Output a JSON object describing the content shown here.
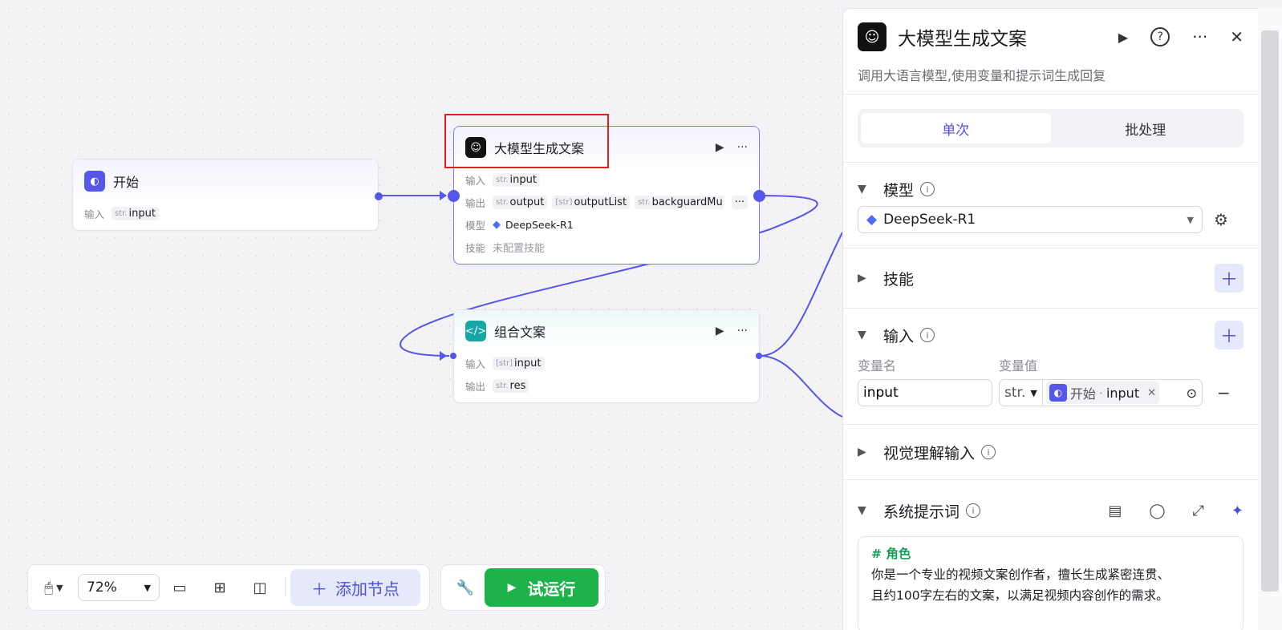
{
  "canvas": {
    "start_node": {
      "title": "开始",
      "input_label": "输入",
      "input_type": "str.",
      "input_name": "input"
    },
    "llm_node": {
      "title": "大模型生成文案",
      "input_label": "输入",
      "input_type": "str.",
      "input_name": "input",
      "output_label": "输出",
      "outputs": [
        {
          "type": "str.",
          "name": "output"
        },
        {
          "type": "[str]",
          "name": "outputList"
        },
        {
          "type": "str.",
          "name": "backguardMu"
        }
      ],
      "model_label": "模型",
      "model_name": "DeepSeek-R1",
      "skill_label": "技能",
      "skill_value": "未配置技能"
    },
    "code_node": {
      "title": "组合文案",
      "input_label": "输入",
      "input_type": "[str]",
      "input_name": "input",
      "output_label": "输出",
      "output_type": "str.",
      "output_name": "res"
    }
  },
  "toolbar": {
    "zoom": "72%",
    "add_node_label": "添加节点",
    "run_label": "试运行"
  },
  "panel": {
    "title": "大模型生成文案",
    "description": "调用大语言模型,使用变量和提示词生成回复",
    "tabs": [
      "单次",
      "批处理"
    ],
    "model_section": "模型",
    "model_value": "DeepSeek-R1",
    "skill_section": "技能",
    "input_section": "输入",
    "var_name_header": "变量名",
    "var_value_header": "变量值",
    "var_name": "input",
    "var_type": "str.",
    "var_ref_node": "开始",
    "var_ref_sep": "·",
    "var_ref_name": "input",
    "vision_section": "视觉理解输入",
    "system_prompt_section": "系统提示词",
    "prompt_heading": "# 角色",
    "prompt_line1": "你是一个专业的视频文案创作者，擅长生成紧密连贯、",
    "prompt_line2": "且约100字左右的文案，以满足视频内容创作的需求。"
  },
  "colors": {
    "accent": "#5457e8",
    "run_green": "#1eb24a",
    "highlight_red": "#e02020"
  }
}
